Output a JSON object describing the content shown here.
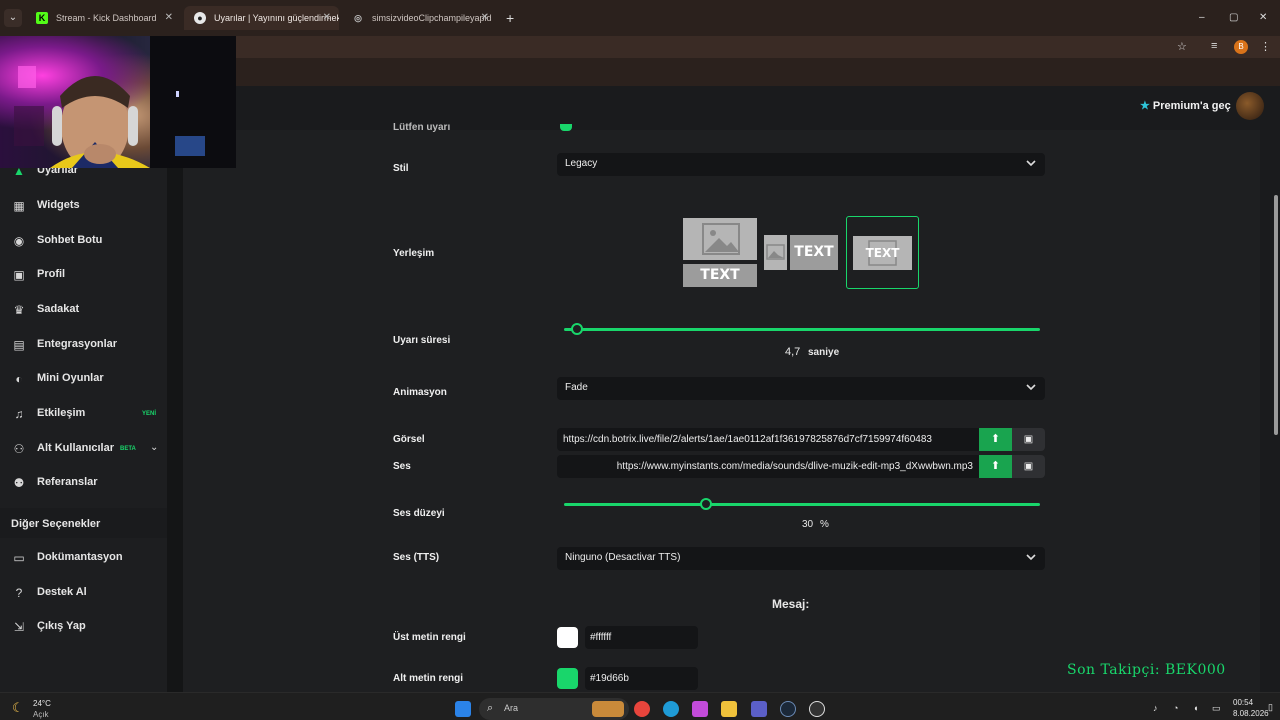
{
  "browser": {
    "tabs": [
      {
        "label": "Stream - Kick Dashboard",
        "favicon": "K",
        "active": false
      },
      {
        "label": "Uyarılar | Yayınını güçlendirmek",
        "favicon": "bot",
        "active": true
      },
      {
        "label": "simsizvideoClipchampileyapld",
        "favicon": "globe",
        "active": false
      }
    ],
    "new_tab": "+",
    "window_controls": {
      "minimize": "–",
      "maximize": "▢",
      "close": "✕"
    },
    "profile_initial": "B"
  },
  "topbar": {
    "premium_label": "Premium'a geç",
    "premium_icon": "star-icon"
  },
  "sidebar": {
    "items": [
      {
        "label": "Uyarılar",
        "icon": "alert-icon"
      },
      {
        "label": "Widgets",
        "icon": "widgets-icon"
      },
      {
        "label": "Sohbet Botu",
        "icon": "bot-icon"
      },
      {
        "label": "Profil",
        "icon": "profile-icon"
      },
      {
        "label": "Sadakat",
        "icon": "trophy-icon"
      },
      {
        "label": "Entegrasyonlar",
        "icon": "integrations-icon"
      },
      {
        "label": "Mini Oyunlar",
        "icon": "gamepad-icon"
      },
      {
        "label": "Etkileşim",
        "icon": "music-icon",
        "badge": "YENİ"
      },
      {
        "label": "Alt Kullanıcılar",
        "icon": "users-icon",
        "badge": "BETA"
      },
      {
        "label": "Referanslar",
        "icon": "referrals-icon"
      }
    ],
    "section_title": "Diğer Seçenekler",
    "other_items": [
      {
        "label": "Dokümantasyon",
        "icon": "docs-icon"
      },
      {
        "label": "Destek Al",
        "icon": "help-icon"
      },
      {
        "label": "Çıkış Yap",
        "icon": "logout-icon"
      }
    ]
  },
  "form": {
    "partial_label": "Lütfen uyarı",
    "style": {
      "label": "Stil",
      "value": "Legacy"
    },
    "layout": {
      "label": "Yerleşim",
      "options": [
        "TEXT",
        "TEXT",
        "TEXT"
      ],
      "selected": 3
    },
    "duration": {
      "label": "Uyarı süresi",
      "value": "4,7",
      "unit": "saniye",
      "fraction": 0.03
    },
    "animation": {
      "label": "Animasyon",
      "value": "Fade"
    },
    "image": {
      "label": "Görsel",
      "value": "https://cdn.botrix.live/file/2/alerts/1ae/1ae0112af1f36197825876d7cf7159974f60483"
    },
    "sound": {
      "label": "Ses",
      "value": "https://www.myinstants.com/media/sounds/dlive-muzik-edit-mp3_dXwwbwn.mp3"
    },
    "volume": {
      "label": "Ses düzeyi",
      "value": "30",
      "unit": "%",
      "fraction": 0.3
    },
    "tts": {
      "label": "Ses (TTS)",
      "value": "Ninguno (Desactivar TTS)"
    },
    "message_heading": "Mesaj:",
    "top_text_color": {
      "label": "Üst metin rengi",
      "value": "#ffffff"
    },
    "bottom_text_color": {
      "label": "Alt metin rengi",
      "value": "#19d66b"
    }
  },
  "overlay": {
    "last_follower": "Son Takipçi: BEK000"
  },
  "taskbar": {
    "weather_temp": "24°C",
    "weather_desc": "Açık",
    "search_label": "Ara",
    "time": "00:54",
    "date": "8.08.2026"
  },
  "colors": {
    "accent": "#19d66b",
    "background": "#1e1f21",
    "sidebar": "#1d1e20"
  }
}
